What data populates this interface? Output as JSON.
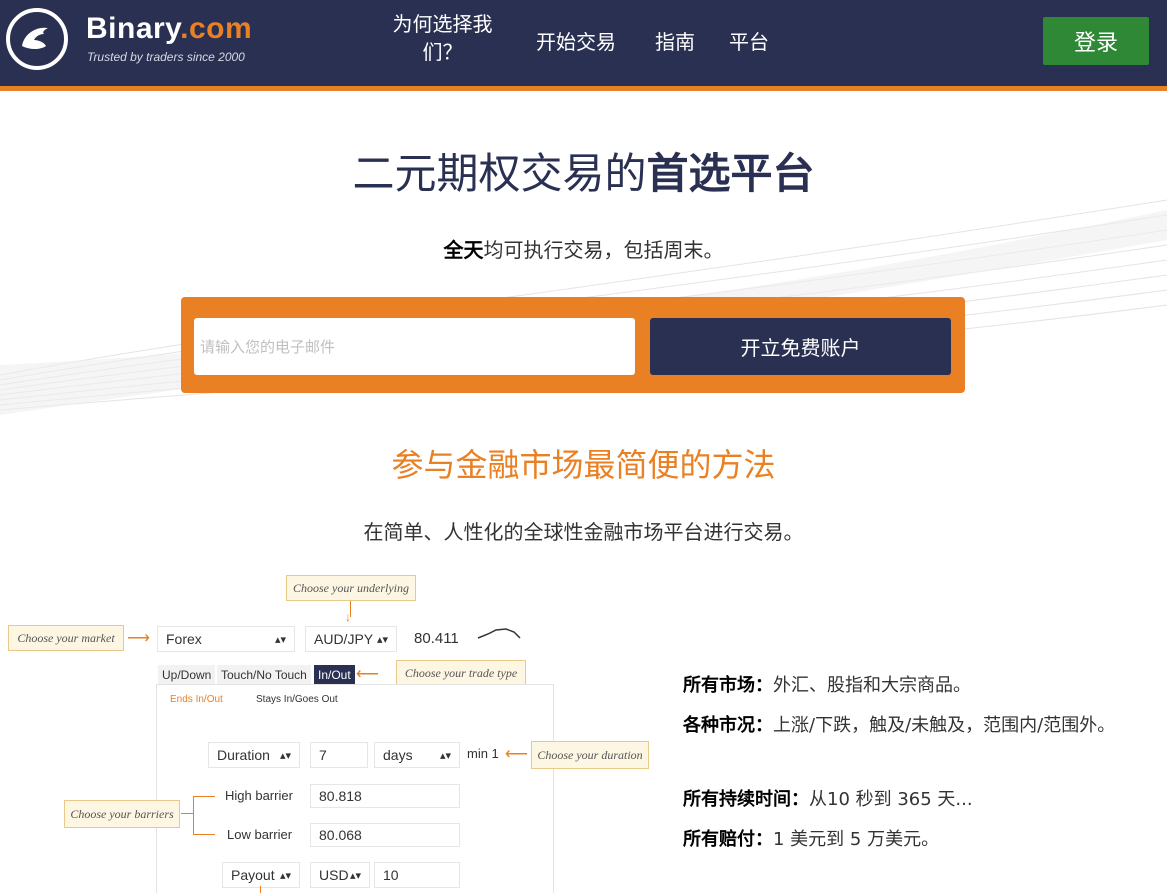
{
  "header": {
    "logo_name": "Binary",
    "logo_suffix": ".com",
    "tagline": "Trusted by traders since 2000",
    "nav": {
      "why_line1": "为何选择我",
      "why_line2": "们？",
      "start": "开始交易",
      "guide": "指南",
      "platform": "平台"
    },
    "login_label": "登录"
  },
  "hero": {
    "title_normal": "二元期权交易的",
    "title_bold": "首选平台",
    "sub_bold": "全天",
    "sub_rest": "均可执行交易，包括周末。",
    "email_placeholder": "请输入您的电子邮件",
    "signup_label": "开立免费账户"
  },
  "section": {
    "title": "参与金融市场最简便的方法",
    "subtitle": "在简单、人性化的全球性金融市场平台进行交易。"
  },
  "demo": {
    "callouts": {
      "underlying": "Choose your underlying",
      "market": "Choose your market",
      "trade_type": "Choose your trade type",
      "duration": "Choose your duration",
      "barriers": "Choose your barriers"
    },
    "market_value": "Forex",
    "underlying_value": "AUD/JPY",
    "price": "80.411",
    "tabs": [
      "Up/Down",
      "Touch/No Touch",
      "In/Out"
    ],
    "subtabs": [
      "Ends In/Out",
      "Stays In/Goes Out"
    ],
    "duration_label": "Duration",
    "duration_value": "7",
    "duration_unit": "days",
    "duration_min": "min 1",
    "high_barrier_label": "High barrier",
    "high_barrier_value": "80.818",
    "low_barrier_label": "Low barrier",
    "low_barrier_value": "80.068",
    "payout_label": "Payout",
    "currency": "USD",
    "payout_value": "10"
  },
  "features": [
    {
      "label": "所有市场：",
      "text": "外汇、股指和大宗商品。"
    },
    {
      "label": "各种市况：",
      "text": "上涨/下跌，触及/未触及，范围内/范围外。"
    },
    {
      "label": "所有持续时间：",
      "text": "从10 秒到 365 天..."
    },
    {
      "label": "所有赔付：",
      "text": "1 美元到 5 万美元。"
    }
  ],
  "colors": {
    "navy": "#2a3052",
    "orange": "#e98024",
    "green": "#2e8836"
  }
}
